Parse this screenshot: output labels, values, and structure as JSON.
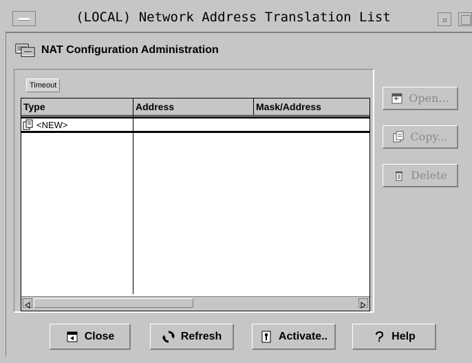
{
  "window": {
    "title": "(LOCAL) Network Address Translation List"
  },
  "header": {
    "title": "NAT Configuration Administration"
  },
  "tabs": {
    "timeout": "Timeout"
  },
  "table": {
    "columns": [
      "Type",
      "Address",
      "Mask/Address"
    ],
    "rows": [
      {
        "type": "<NEW>",
        "address": "",
        "mask": ""
      }
    ]
  },
  "side_buttons": {
    "open": "Open...",
    "copy": "Copy...",
    "delete": "Delete"
  },
  "bottom_buttons": {
    "close": "Close",
    "refresh": "Refresh",
    "activate": "Activate..",
    "help": "Help"
  }
}
